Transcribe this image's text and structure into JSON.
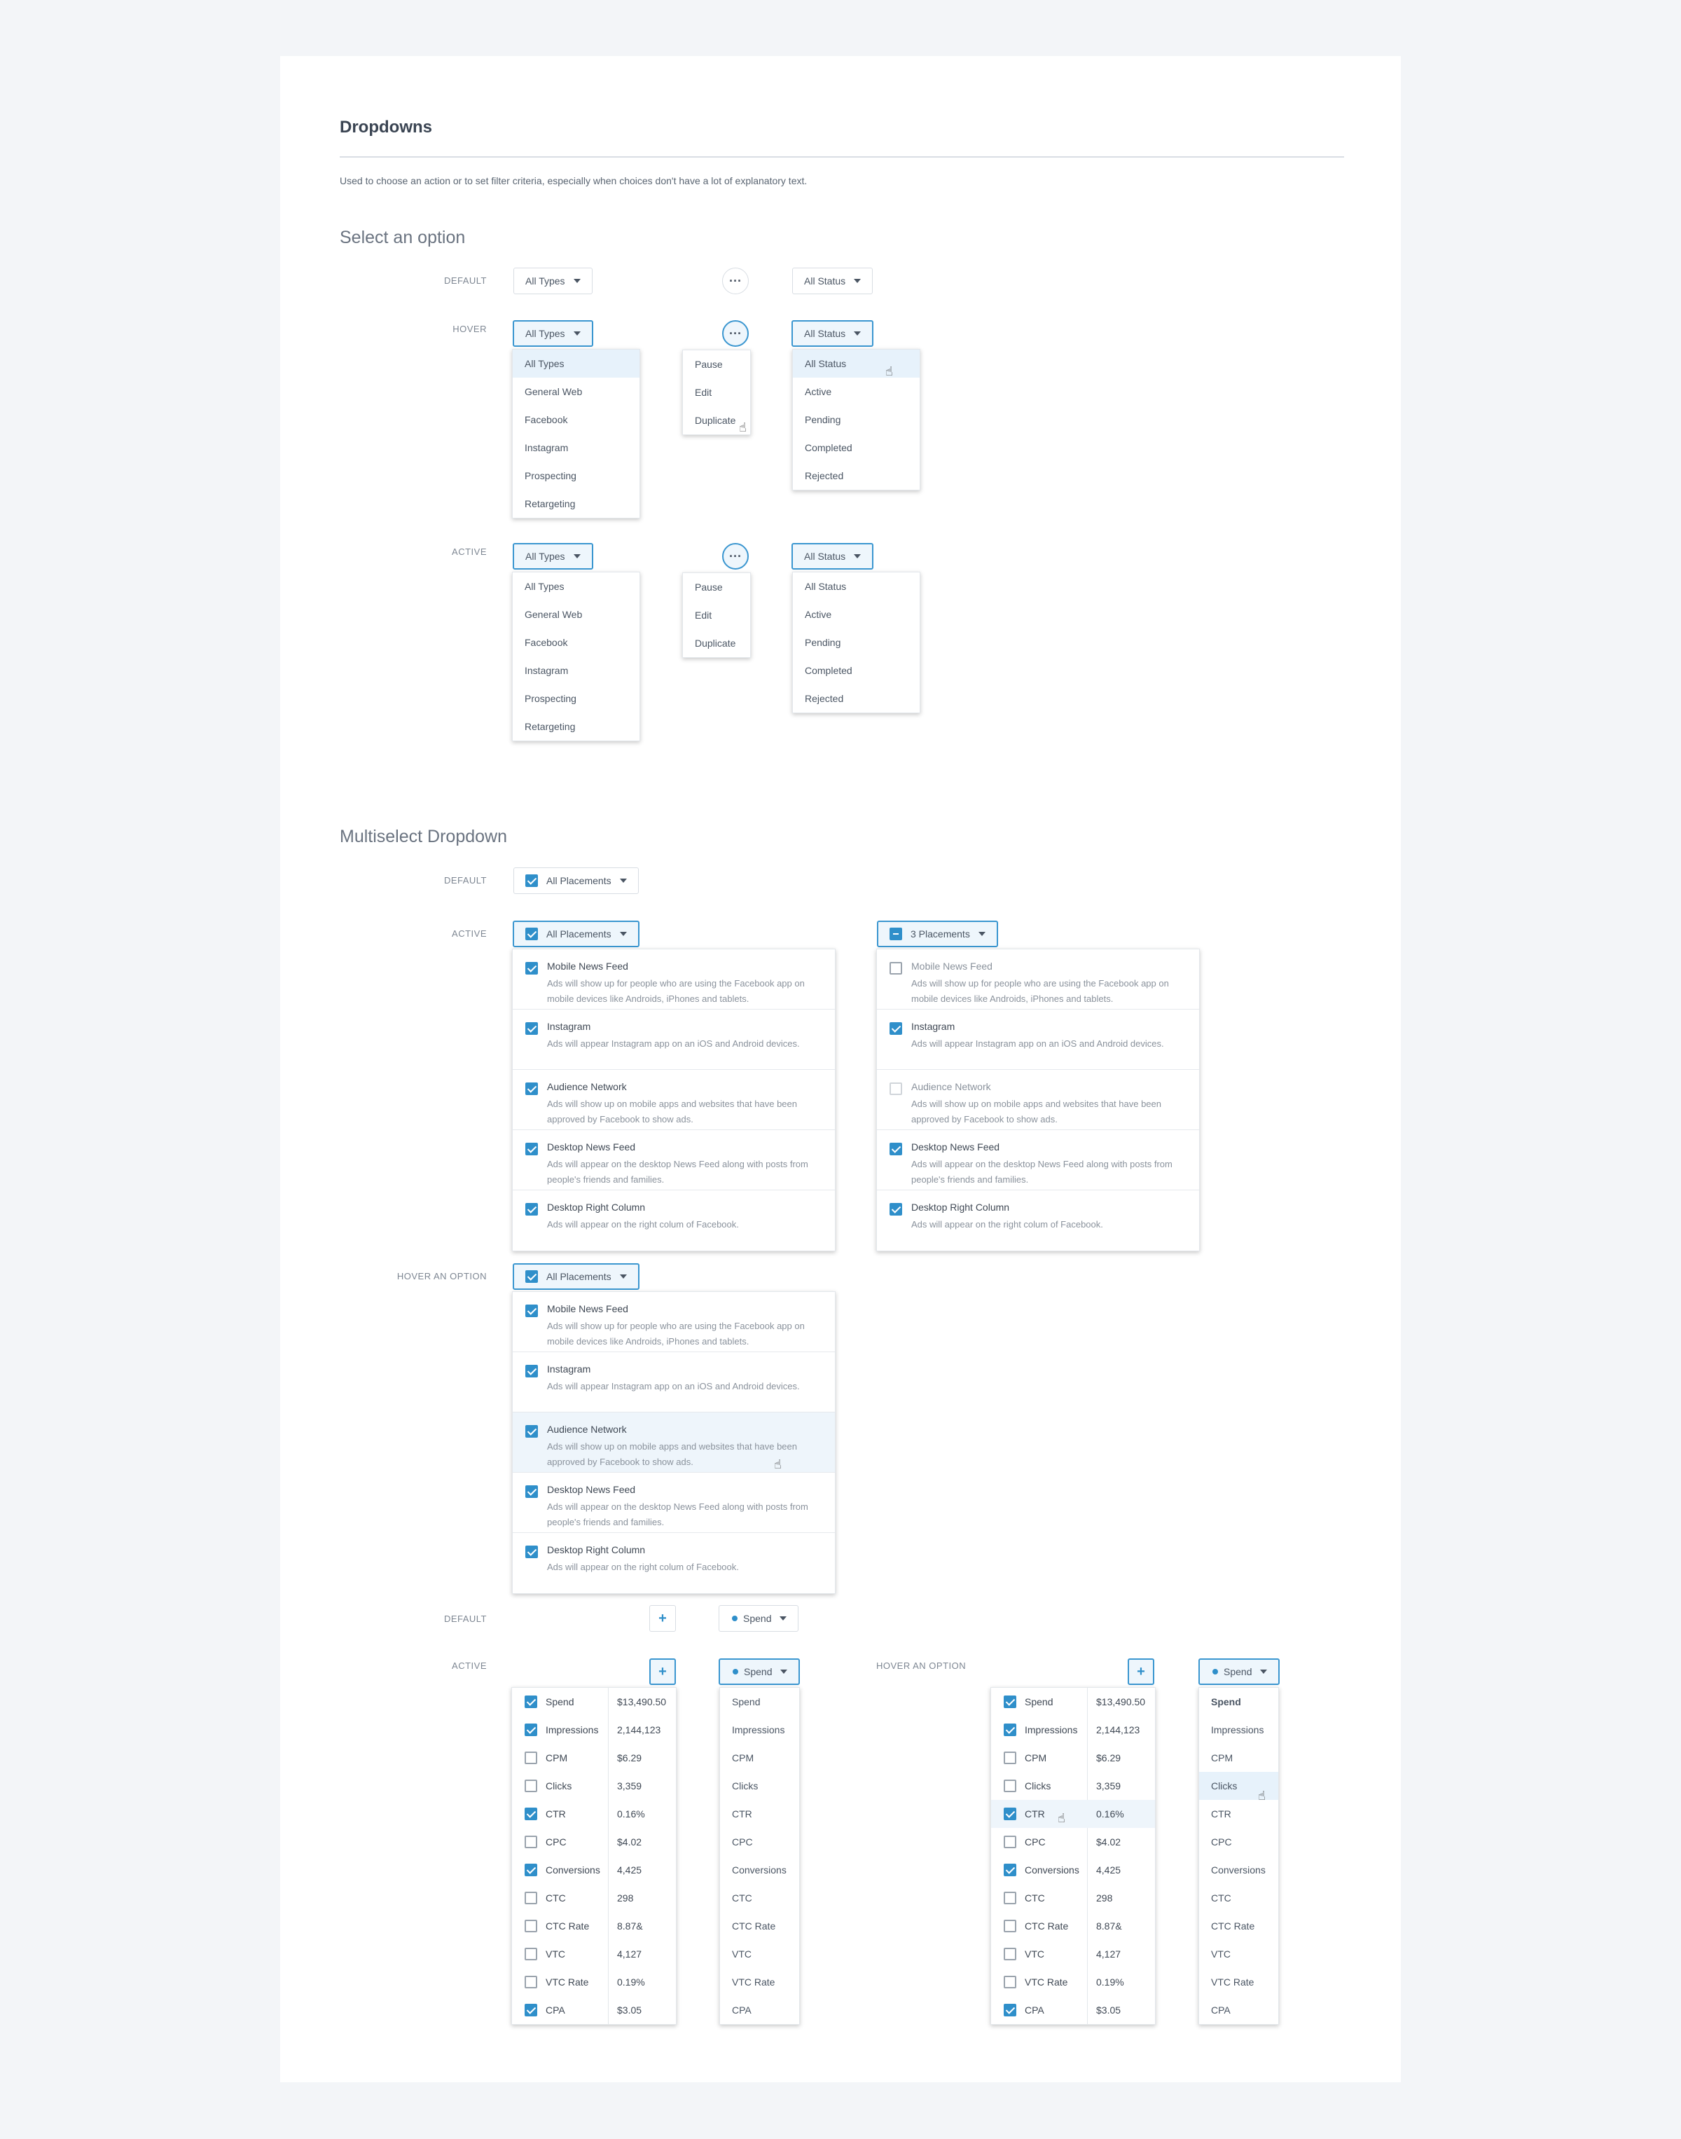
{
  "page": {
    "title": "Dropdowns",
    "description": "Used to choose an action or to set filter criteria, especially when choices don't have a lot of explanatory text."
  },
  "select": {
    "heading": "Select an option",
    "labels": {
      "default": "DEFAULT",
      "hover": "HOVER",
      "active": "ACTIVE"
    },
    "types_button": "All Types",
    "status_button": "All Status",
    "more_icon": "ellipsis-icon",
    "types_options": [
      "All Types",
      "General Web",
      "Facebook",
      "Instagram",
      "Prospecting",
      "Retargeting"
    ],
    "actions_options": [
      "Pause",
      "Edit",
      "Duplicate"
    ],
    "status_options": [
      "All Status",
      "Active",
      "Pending",
      "Completed",
      "Rejected"
    ]
  },
  "multiselect": {
    "heading": "Multiselect Dropdown",
    "labels": {
      "default": "DEFAULT",
      "active": "ACTIVE",
      "hover": "HOVER AN OPTION"
    },
    "all_button": "All Placements",
    "partial_button": "3 Placements",
    "placements": [
      {
        "title": "Mobile News Feed",
        "desc": "Ads will show up for people who are using the Facebook app on mobile devices like Androids, iPhones and tablets."
      },
      {
        "title": "Instagram",
        "desc": "Ads will appear Instagram app on an iOS and Android devices."
      },
      {
        "title": "Audience Network",
        "desc": "Ads will show up on mobile apps and websites that have been approved by Facebook to show ads."
      },
      {
        "title": "Desktop News Feed",
        "desc": "Ads will appear on the desktop News Feed along with posts from people's friends and families."
      },
      {
        "title": "Desktop Right Column",
        "desc": "Ads will appear on the right colum of Facebook."
      }
    ]
  },
  "metrics": {
    "labels": {
      "default": "DEFAULT",
      "active": "ACTIVE",
      "hover": "HOVER AN OPTION"
    },
    "add_icon": "plus-icon",
    "spend_button": "Spend",
    "accent": "#2f8fca",
    "rows": [
      {
        "name": "Spend",
        "value": "$13,490.50",
        "checked": true
      },
      {
        "name": "Impressions",
        "value": "2,144,123",
        "checked": true
      },
      {
        "name": "CPM",
        "value": "$6.29",
        "checked": false
      },
      {
        "name": "Clicks",
        "value": "3,359",
        "checked": false
      },
      {
        "name": "CTR",
        "value": "0.16%",
        "checked": true
      },
      {
        "name": "CPC",
        "value": "$4.02",
        "checked": false
      },
      {
        "name": "Conversions",
        "value": "4,425",
        "checked": true
      },
      {
        "name": "CTC",
        "value": "298",
        "checked": false
      },
      {
        "name": "CTC Rate",
        "value": "8.87&",
        "checked": false
      },
      {
        "name": "VTC",
        "value": "4,127",
        "checked": false
      },
      {
        "name": "VTC Rate",
        "value": "0.19%",
        "checked": false
      },
      {
        "name": "CPA",
        "value": "$3.05",
        "checked": true
      }
    ]
  }
}
